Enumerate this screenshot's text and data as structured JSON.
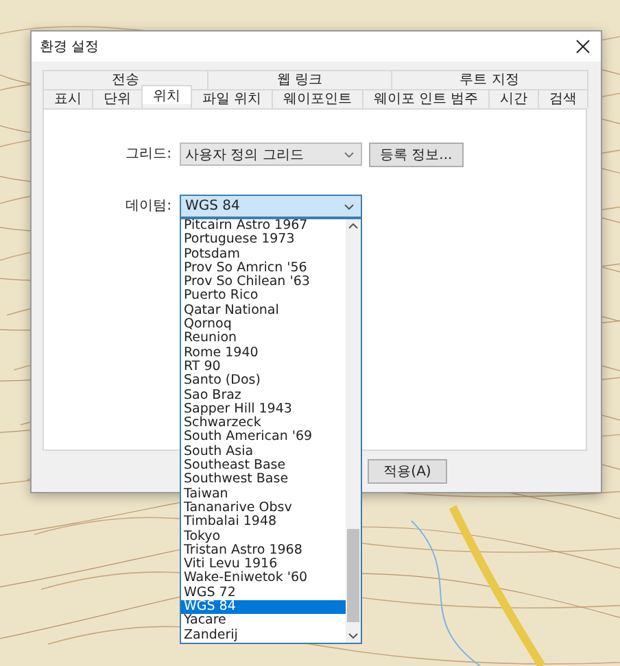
{
  "window": {
    "title": "환경 설정"
  },
  "tab_rows": [
    [
      {
        "label": "전송",
        "selected": false
      },
      {
        "label": "웹 링크",
        "selected": false
      },
      {
        "label": "루트 지정",
        "selected": false
      }
    ],
    [
      {
        "label": "표시",
        "selected": false
      },
      {
        "label": "단위",
        "selected": false
      },
      {
        "label": "위치",
        "selected": true
      },
      {
        "label": "파일 위치",
        "selected": false
      },
      {
        "label": "웨이포인트",
        "selected": false
      },
      {
        "label": "웨이포 인트 범주",
        "selected": false
      },
      {
        "label": "시간",
        "selected": false
      },
      {
        "label": "검색",
        "selected": false
      }
    ]
  ],
  "grid": {
    "label": "그리드:",
    "value": "사용자 정의 그리드",
    "button": "등록 정보..."
  },
  "datum": {
    "label": "데이텀:",
    "value": "WGS 84",
    "expanded": true,
    "options": [
      {
        "label": "Pitcairn Astro 1967",
        "selected": false
      },
      {
        "label": "Portuguese 1973",
        "selected": false
      },
      {
        "label": "Potsdam",
        "selected": false
      },
      {
        "label": "Prov So Amricn '56",
        "selected": false
      },
      {
        "label": "Prov So Chilean '63",
        "selected": false
      },
      {
        "label": "Puerto Rico",
        "selected": false
      },
      {
        "label": "Qatar National",
        "selected": false
      },
      {
        "label": "Qornoq",
        "selected": false
      },
      {
        "label": "Reunion",
        "selected": false
      },
      {
        "label": "Rome 1940",
        "selected": false
      },
      {
        "label": "RT 90",
        "selected": false
      },
      {
        "label": "Santo (Dos)",
        "selected": false
      },
      {
        "label": "Sao Braz",
        "selected": false
      },
      {
        "label": "Sapper Hill 1943",
        "selected": false
      },
      {
        "label": "Schwarzeck",
        "selected": false
      },
      {
        "label": "South American '69",
        "selected": false
      },
      {
        "label": "South Asia",
        "selected": false
      },
      {
        "label": "Southeast Base",
        "selected": false
      },
      {
        "label": "Southwest Base",
        "selected": false
      },
      {
        "label": "Taiwan",
        "selected": false
      },
      {
        "label": "Tananarive Obsv",
        "selected": false
      },
      {
        "label": "Timbalai 1948",
        "selected": false
      },
      {
        "label": "Tokyo",
        "selected": false
      },
      {
        "label": "Tristan Astro 1968",
        "selected": false
      },
      {
        "label": "Viti Levu 1916",
        "selected": false
      },
      {
        "label": "Wake-Eniwetok '60",
        "selected": false
      },
      {
        "label": "WGS 72",
        "selected": false
      },
      {
        "label": "WGS 84",
        "selected": true
      },
      {
        "label": "Yacare",
        "selected": false
      },
      {
        "label": "Zanderij",
        "selected": false
      }
    ]
  },
  "buttons": [
    "적용(A)"
  ]
}
